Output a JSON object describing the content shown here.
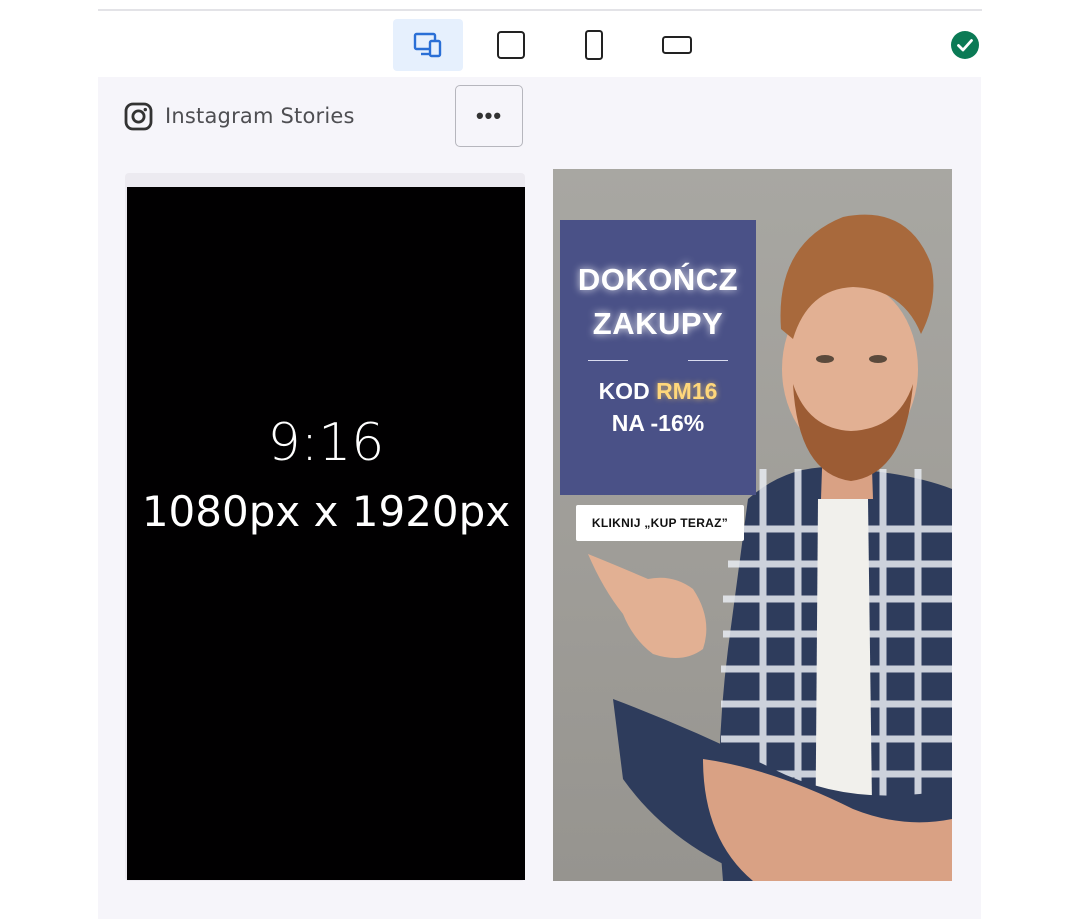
{
  "toolbar": {
    "devices": [
      {
        "name": "responsive-view",
        "active": true
      },
      {
        "name": "tablet-portrait-view",
        "active": false
      },
      {
        "name": "phone-portrait-view",
        "active": false
      },
      {
        "name": "landscape-view",
        "active": false
      }
    ],
    "status": "ok"
  },
  "platform": {
    "label": "Instagram Stories",
    "icon": "instagram-icon",
    "more_label": "•••"
  },
  "preview": {
    "ratio": "9:16",
    "dimensions": "1080px x 1920px"
  },
  "ad": {
    "headline_line1": "DOKOŃCZ",
    "headline_line2": "ZAKUPY",
    "code_prefix": "KOD ",
    "code_value": "RM16",
    "discount": "NA -16%",
    "cta_label": "KLIKNIJ „KUP TERAZ”"
  },
  "colors": {
    "active_tab_bg": "#e6f0fd",
    "accent_blue": "#2a6fd6",
    "success_green": "#0b7a55",
    "promo_bg": "#4a5187",
    "code_highlight": "#ffd77b"
  }
}
